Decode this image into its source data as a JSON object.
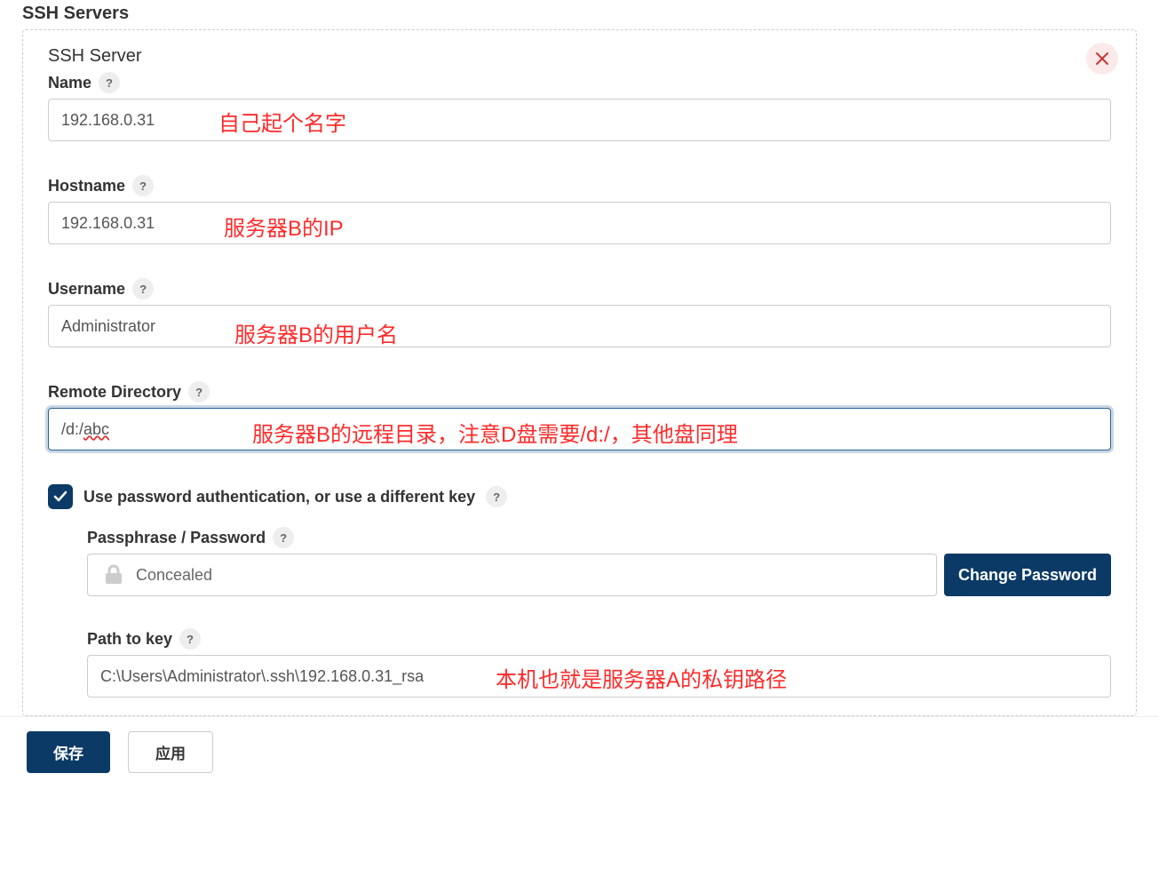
{
  "section_title": "SSH Servers",
  "panel": {
    "title": "SSH Server",
    "fields": {
      "name": {
        "label": "Name",
        "value": "192.168.0.31",
        "annotation": "自己起个名字"
      },
      "hostname": {
        "label": "Hostname",
        "value": "192.168.0.31",
        "annotation": "服务器B的IP"
      },
      "username": {
        "label": "Username",
        "value": "Administrator",
        "annotation": "服务器B的用户名"
      },
      "remote_dir": {
        "label": "Remote Directory",
        "value_prefix": "/d:/",
        "value_suffix": "abc",
        "annotation": "服务器B的远程目录，注意D盘需要/d:/，其他盘同理"
      }
    },
    "auth": {
      "checkbox_label": "Use password authentication, or use a different key",
      "passphrase": {
        "label": "Passphrase / Password",
        "value": "Concealed",
        "change_label": "Change Password"
      },
      "path_to_key": {
        "label": "Path to key",
        "value": "C:\\Users\\Administrator\\.ssh\\192.168.0.31_rsa",
        "annotation": "本机也就是服务器A的私钥路径"
      }
    }
  },
  "footer": {
    "save": "保存",
    "apply": "应用"
  },
  "help_glyph": "?"
}
